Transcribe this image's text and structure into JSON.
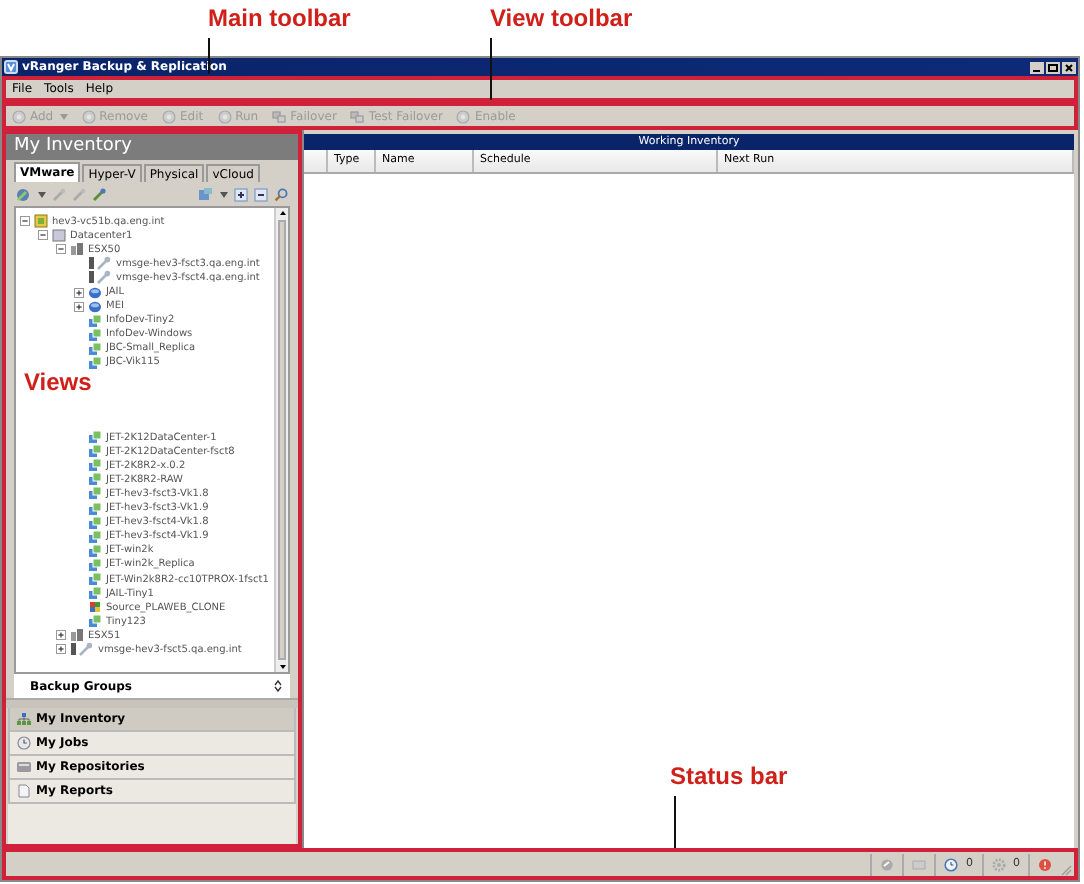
{
  "annotations": [
    {
      "label": "Main toolbar",
      "kind": "menu_bar"
    },
    {
      "label": "View toolbar",
      "kind": "view_toolbar"
    },
    {
      "label": "Views",
      "kind": "views_panel"
    },
    {
      "label": "Status bar",
      "kind": "status_bar"
    }
  ],
  "window": {
    "title": "vRanger Backup & Replication"
  },
  "menu": [
    "File",
    "Tools",
    "Help"
  ],
  "toolbar": [
    {
      "label": "Add",
      "kind": "add",
      "disabled": true,
      "dropdown": true
    },
    {
      "label": "Remove",
      "kind": "remove",
      "disabled": true,
      "dropdown": false
    },
    {
      "label": "Edit",
      "kind": "edit",
      "disabled": true,
      "dropdown": false
    },
    {
      "label": "Run",
      "kind": "run",
      "disabled": true,
      "dropdown": false
    },
    {
      "label": "Failover",
      "kind": "failover",
      "disabled": true,
      "dropdown": false
    },
    {
      "label": "Test Failover",
      "kind": "test",
      "disabled": true,
      "dropdown": false
    },
    {
      "label": "Enable",
      "kind": "enable",
      "disabled": true,
      "dropdown": false
    }
  ],
  "inventory": {
    "title": "My Inventory",
    "tabs": [
      {
        "label": "VMware",
        "selected": true
      },
      {
        "label": "Hyper-V",
        "selected": false
      },
      {
        "label": "Physical",
        "selected": false
      },
      {
        "label": "vCloud",
        "selected": false
      }
    ],
    "tree": [
      {
        "label": "hev3-vc51b.qa.eng.int",
        "kind": "vcenter",
        "expanded": true,
        "children": [
          {
            "label": "Datacenter1",
            "kind": "datacenter",
            "expanded": true,
            "children": [
              {
                "label": "ESX50",
                "kind": "cluster",
                "expanded": true,
                "children": [
                  {
                    "label": "vmsge-hev3-fsct3.qa.eng.int",
                    "kind": "host"
                  },
                  {
                    "label": "vmsge-hev3-fsct4.qa.eng.int",
                    "kind": "host"
                  },
                  {
                    "label": "JAIL",
                    "kind": "pool",
                    "expanded": false
                  },
                  {
                    "label": "MEI",
                    "kind": "pool",
                    "expanded": false
                  },
                  {
                    "label": "InfoDev-Tiny2",
                    "kind": "vm"
                  },
                  {
                    "label": "InfoDev-Windows",
                    "kind": "vm"
                  },
                  {
                    "label": "JBC-Small_Replica",
                    "kind": "vm"
                  },
                  {
                    "label": "JBC-Vik115",
                    "kind": "vm"
                  },
                  {
                    "label": "JET-2K12DataCenter-1",
                    "kind": "vm",
                    "gap_above": true
                  },
                  {
                    "label": "JET-2K12DataCenter-fsct8",
                    "kind": "vm"
                  },
                  {
                    "label": "JET-2K8R2-x.0.2",
                    "kind": "vm"
                  },
                  {
                    "label": "JET-2K8R2-RAW",
                    "kind": "vm"
                  },
                  {
                    "label": "JET-hev3-fsct3-Vk1.8",
                    "kind": "vm"
                  },
                  {
                    "label": "JET-hev3-fsct3-Vk1.9",
                    "kind": "vm"
                  },
                  {
                    "label": "JET-hev3-fsct4-Vk1.8",
                    "kind": "vm"
                  },
                  {
                    "label": "JET-hev3-fsct4-Vk1.9",
                    "kind": "vm"
                  },
                  {
                    "label": "JET-win2k",
                    "kind": "vm"
                  },
                  {
                    "label": "JET-win2k_Replica",
                    "kind": "vm"
                  },
                  {
                    "label": "JET-Win2k8R2-cc10TPROX-1fsct1",
                    "kind": "vm"
                  },
                  {
                    "label": "JAIL-Tiny1",
                    "kind": "vm"
                  },
                  {
                    "label": "Source_PLAWEB_CLONE",
                    "kind": "template"
                  },
                  {
                    "label": "Tiny123",
                    "kind": "vm"
                  }
                ]
              },
              {
                "label": "ESX51",
                "kind": "cluster",
                "expanded": false
              },
              {
                "label": "vmsge-hev3-fsct5.qa.eng.int",
                "kind": "host",
                "expanded": false
              }
            ]
          }
        ]
      }
    ]
  },
  "backup_groups": {
    "label": "Backup Groups"
  },
  "nav": [
    {
      "label": "My Inventory",
      "kind": "inventory",
      "selected": true
    },
    {
      "label": "My Jobs",
      "kind": "jobs",
      "selected": false
    },
    {
      "label": "My Repositories",
      "kind": "repositories",
      "selected": false
    },
    {
      "label": "My Reports",
      "kind": "reports",
      "selected": false
    }
  ],
  "working_inventory": {
    "title": "Working Inventory",
    "columns": [
      "Type",
      "Name",
      "Schedule",
      "Next Run"
    ]
  },
  "status_bar": {
    "counts": [
      "0",
      "0"
    ]
  }
}
